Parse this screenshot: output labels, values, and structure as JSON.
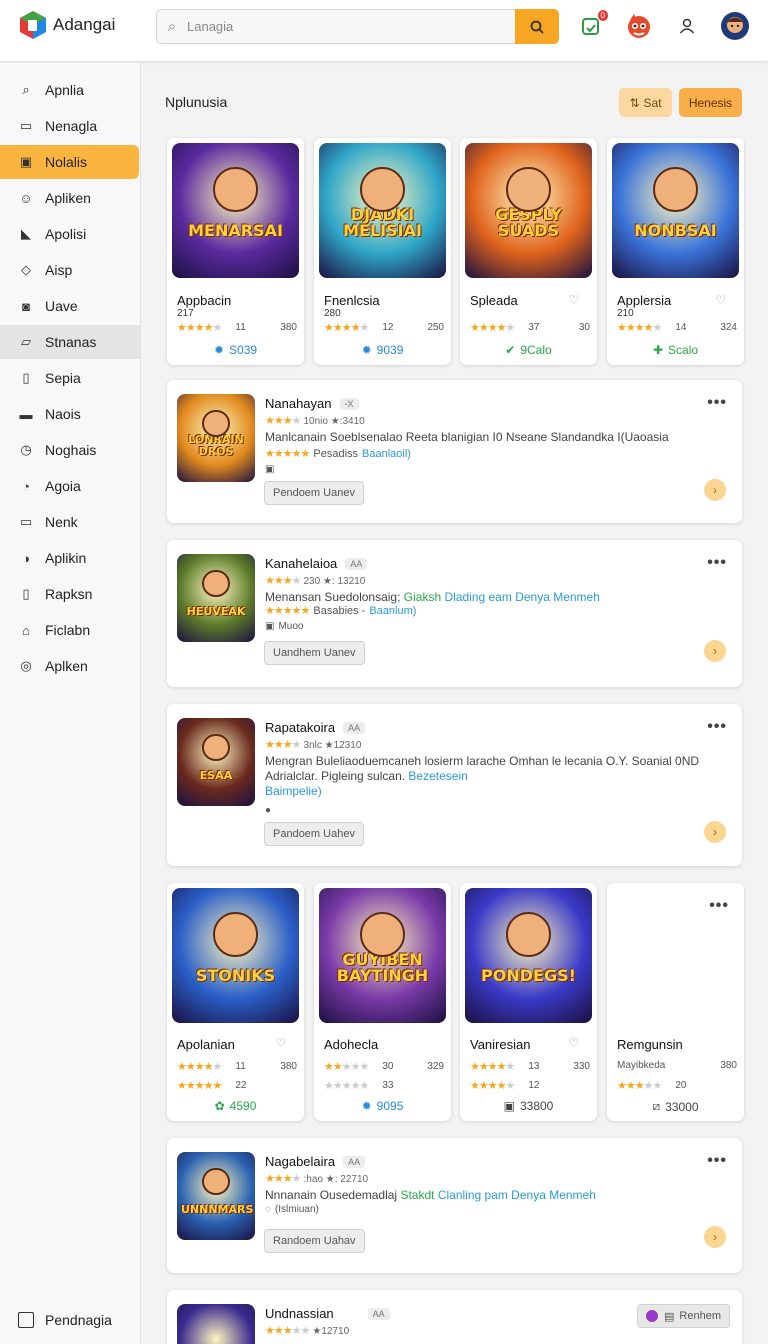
{
  "app": {
    "name": "Adangai"
  },
  "search": {
    "placeholder": "Lanagia"
  },
  "header": {
    "badge_count": "0"
  },
  "sidebar": {
    "items": [
      {
        "label": "Apnlia",
        "icon": "search-icon"
      },
      {
        "label": "Nenagla",
        "icon": "window-icon"
      },
      {
        "label": "Nolalis",
        "icon": "chip-icon",
        "active": true
      },
      {
        "label": "Apliken",
        "icon": "smile-icon"
      },
      {
        "label": "Apolisi",
        "icon": "tag-icon"
      },
      {
        "label": "Aisp",
        "icon": "diamond-icon"
      },
      {
        "label": "Uave",
        "icon": "camera-icon"
      },
      {
        "label": "Stnanas",
        "icon": "folder-icon"
      },
      {
        "label": "Sepia",
        "icon": "list-icon"
      },
      {
        "label": "Naois",
        "icon": "gamepad-icon"
      },
      {
        "label": "Noghais",
        "icon": "clock-icon"
      },
      {
        "label": "Agoia",
        "icon": "timer-icon"
      },
      {
        "label": "Nenk",
        "icon": "bookmark-icon"
      },
      {
        "label": "Aplikin",
        "icon": "play-icon"
      },
      {
        "label": "Rapksn",
        "icon": "box-icon"
      },
      {
        "label": "Ficlabn",
        "icon": "bag-icon"
      },
      {
        "label": "Aplken",
        "icon": "target-icon"
      }
    ],
    "footer": "Pendnagia"
  },
  "main": {
    "title": "Nplunusia",
    "btn_sort": "Sat",
    "btn_primary": "Henesis"
  },
  "grid1": [
    {
      "title": "Appbacin",
      "sub": "217",
      "stars": 4,
      "count": "11",
      "num": "380",
      "price": "S039",
      "price_icon": "gear-icon",
      "price_color": "#2a8ad6",
      "thumb_text": "MENARSAI",
      "thumb_bg": "#5a2a9e",
      "heart": false
    },
    {
      "title": "Fnenlcsia",
      "sub": "280",
      "stars": 4,
      "count": "12",
      "num": "250",
      "price": "9039",
      "price_icon": "gear-icon",
      "price_color": "#2a8ad6",
      "thumb_text": "DJADKI MELISIAI",
      "thumb_bg": "#2fa6c8",
      "heart": false
    },
    {
      "title": "Spleada",
      "sub": "",
      "stars": 4,
      "count": "37",
      "num": "30",
      "price": "9Calo",
      "price_icon": "check-icon",
      "price_color": "#27a84a",
      "thumb_text": "GESPLY SUADS",
      "thumb_bg": "#e0631c",
      "heart": true
    },
    {
      "title": "Applersia",
      "sub": "210",
      "stars": 4,
      "count": "14",
      "num": "324",
      "price": "Scalo",
      "price_icon": "puzzle-icon",
      "price_color": "#27a84a",
      "thumb_text": "NONBSAI",
      "thumb_bg": "#3a73d8",
      "heart": true
    }
  ],
  "list1": [
    {
      "title": "Nanahayan",
      "tag": "-X",
      "meta": "10nio ★:3410",
      "desc": "Manlcanain Soeblsenalao Reeta blanigian I0 Nseane Slandandka I(Uaoasia",
      "rate_label": "Pesadiss",
      "rate_link": "Baanlaoil)",
      "extra": "",
      "button": "Pendoem Uanev",
      "thumb_text": "LONRAIN DROS",
      "thumb_bg": "#e28a1e"
    },
    {
      "title": "Kanahelaioa",
      "tag": "AA",
      "meta": "230 ★: 13210",
      "desc_plain": "Menansan Suedolonsaig;",
      "desc_green": "Giaksh",
      "desc_blue": "Dlading eam Denya Menmeh",
      "rate_label": "Basabies -",
      "rate_link": "Baanlum)",
      "extra": "Muoo",
      "button": "Uandhem Uanev",
      "thumb_text": "HEUVEAK",
      "thumb_bg": "#5c7a2a"
    },
    {
      "title": "Rapatakoira",
      "tag": "AA",
      "meta": "3nlc ★12310",
      "desc": "Mengran Buleliaoduemcaneh losierm larache Omhan le lecania O.Y. Soanial 0ND Adrialclar. Pigleing sulcan.",
      "desc_link": "Bezetesein",
      "desc_link2": "Baimpelie)",
      "extra": "",
      "button": "Pandoem Uahev",
      "thumb_text": "ESAA",
      "thumb_bg": "#6a2a1e"
    }
  ],
  "grid2": [
    {
      "title": "Apolanian",
      "stars": 4,
      "count": "11",
      "num": "380",
      "stars2": 5,
      "count2": "22",
      "price": "4590",
      "price_icon": "flower-icon",
      "price_color": "#27a84a",
      "thumb_text": "STONIKS",
      "thumb_bg": "#2a5fc8",
      "heart": true
    },
    {
      "title": "Adohecla",
      "stars": 2,
      "count": "30",
      "num": "329",
      "stars2": 0,
      "count2": "33",
      "price": "9095",
      "price_icon": "gear-icon",
      "price_color": "#2a8ad6",
      "thumb_text": "GUYIBEN BAYTINGH",
      "thumb_bg": "#7a3aa8",
      "heart": false
    },
    {
      "title": "Vaniresian",
      "stars": 4,
      "count": "13",
      "num": "330",
      "stars2": 4,
      "count2": "12",
      "price": "33800",
      "price_icon": "square-icon",
      "price_color": "#444",
      "thumb_text": "PONDEGS!",
      "thumb_bg": "#3a3ac8",
      "heart": true
    },
    {
      "title": "Remgunsin",
      "sub": "Mayibkeda",
      "num": "380",
      "stars2": 3,
      "count2": "20",
      "price": "33000",
      "price_icon": "slash-icon",
      "price_color": "#444",
      "thumb_text": "",
      "thumb_bg": "",
      "heart": false
    }
  ],
  "list2": [
    {
      "title": "Nagabelaira",
      "tag": "AA",
      "meta": ":hao ★: 22710",
      "desc_plain": "Nnnanain Ousedemadlaj",
      "desc_green": "Stakdt",
      "desc_blue": "Clanling pam Denya Menmeh",
      "extra": "(Islmiuan)",
      "button": "Randoem Uahav",
      "thumb_text": "UNNNMARS",
      "thumb_bg": "#2a62b0"
    },
    {
      "title": "Undnassian",
      "tag": "AA",
      "meta": "★12710",
      "button": "Renhem",
      "thumb_text": "",
      "thumb_bg": "#3a2a8e"
    }
  ]
}
